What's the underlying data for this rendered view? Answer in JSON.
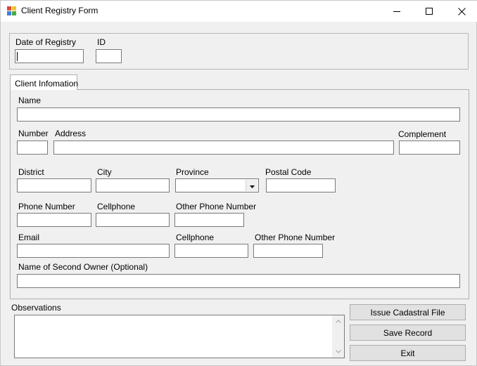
{
  "window": {
    "title": "Client Registry Form",
    "icons": {
      "app": "form-app-icon",
      "minimize": "minimize-icon",
      "maximize": "maximize-icon",
      "close": "close-icon"
    }
  },
  "header_group": {
    "date_label": "Date of Registry",
    "date_value": "",
    "id_label": "ID",
    "id_value": ""
  },
  "tabs": [
    {
      "label": "Client Infomation"
    }
  ],
  "client": {
    "name_label": "Name",
    "name_value": "",
    "number_label": "Number",
    "number_value": "",
    "address_label": "Address",
    "address_value": "",
    "complement_label": "Complement",
    "complement_value": "",
    "district_label": "District",
    "district_value": "",
    "city_label": "City",
    "city_value": "",
    "province_label": "Province",
    "province_value": "",
    "postal_label": "Postal Code",
    "postal_value": "",
    "phone_label": "Phone Number",
    "phone_value": "",
    "cellphone_label": "Cellphone",
    "cellphone_value": "",
    "other_phone_label": "Other Phone Number",
    "other_phone_value": "",
    "email_label": "Email",
    "email_value": "",
    "cellphone2_label": "Cellphone",
    "cellphone2_value": "",
    "other_phone2_label": "Other Phone Number",
    "other_phone2_value": "",
    "second_owner_label": "Name of Second Owner (Optional)",
    "second_owner_value": ""
  },
  "observations": {
    "label": "Observations",
    "value": ""
  },
  "buttons": {
    "issue": "Issue Cadastral File",
    "save": "Save Record",
    "exit": "Exit"
  }
}
